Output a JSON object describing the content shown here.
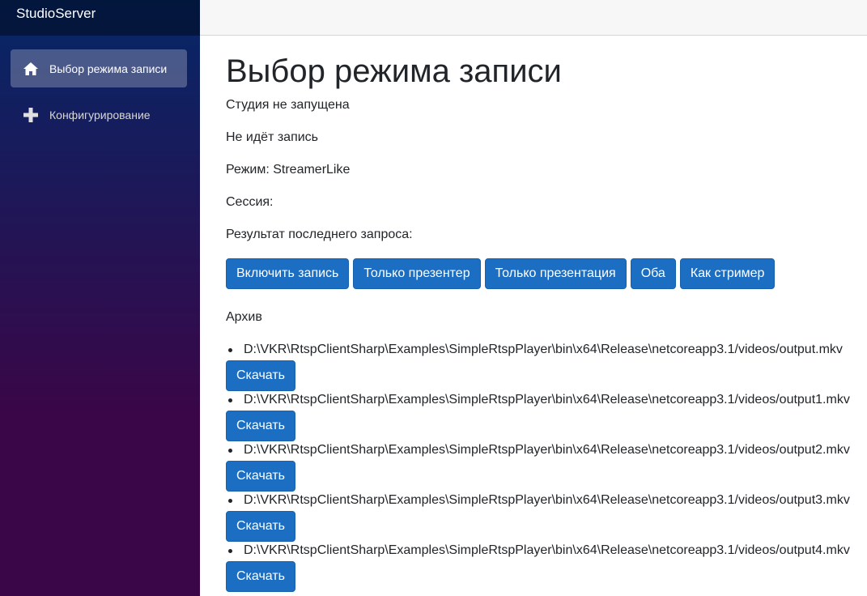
{
  "app": {
    "brand": "StudioServer"
  },
  "sidebar": {
    "items": [
      {
        "label": "Выбор режима записи",
        "icon": "home-icon",
        "active": true
      },
      {
        "label": "Конфигурирование",
        "icon": "plus-icon",
        "active": false
      }
    ]
  },
  "main": {
    "title": "Выбор режима записи",
    "status": {
      "studio": "Студия не запущена",
      "recording": "Не идёт запись",
      "mode": "Режим: StreamerLike",
      "session": "Сессия:",
      "last_result": "Результат последнего запроса:"
    },
    "buttons": {
      "enable_recording": "Включить запись",
      "presenter_only": "Только презентер",
      "presentation_only": "Только презентация",
      "both": "Оба",
      "as_streamer": "Как стример"
    },
    "archive": {
      "title": "Архив",
      "download_label": "Скачать",
      "files": [
        "D:\\VKR\\RtspClientSharp\\Examples\\SimpleRtspPlayer\\bin\\x64\\Release\\netcoreapp3.1/videos/output.mkv",
        "D:\\VKR\\RtspClientSharp\\Examples\\SimpleRtspPlayer\\bin\\x64\\Release\\netcoreapp3.1/videos/output1.mkv",
        "D:\\VKR\\RtspClientSharp\\Examples\\SimpleRtspPlayer\\bin\\x64\\Release\\netcoreapp3.1/videos/output2.mkv",
        "D:\\VKR\\RtspClientSharp\\Examples\\SimpleRtspPlayer\\bin\\x64\\Release\\netcoreapp3.1/videos/output3.mkv",
        "D:\\VKR\\RtspClientSharp\\Examples\\SimpleRtspPlayer\\bin\\x64\\Release\\netcoreapp3.1/videos/output4.mkv"
      ]
    }
  },
  "colors": {
    "sidebar_top": "#052767",
    "sidebar_bottom": "#3a0647",
    "button": "#1b6ec2",
    "top_row": "#f7f7f7"
  }
}
